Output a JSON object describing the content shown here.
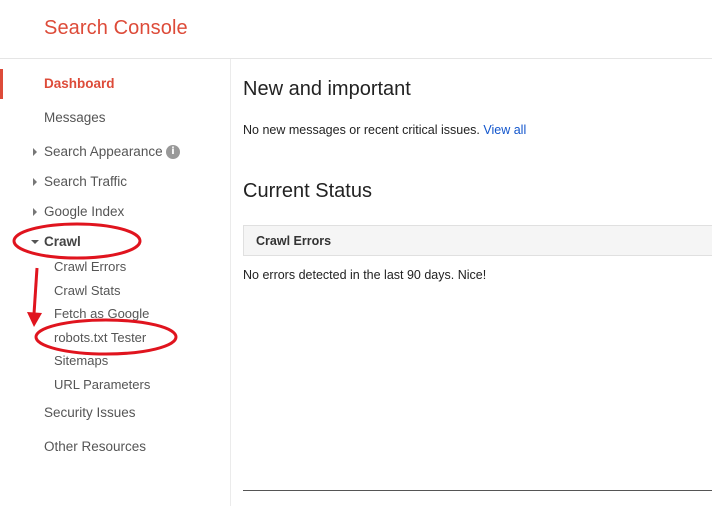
{
  "header": {
    "brand": "Search Console"
  },
  "sidebar": {
    "dashboard": "Dashboard",
    "messages": "Messages",
    "search_appearance": "Search Appearance",
    "search_traffic": "Search Traffic",
    "google_index": "Google Index",
    "crawl": "Crawl",
    "crawl_items": [
      "Crawl Errors",
      "Crawl Stats",
      "Fetch as Google",
      "robots.txt Tester",
      "Sitemaps",
      "URL Parameters"
    ],
    "security_issues": "Security Issues",
    "other_resources": "Other Resources",
    "info_glyph": "i"
  },
  "main": {
    "new_title": "New and important",
    "new_message": "No new messages or recent critical issues.",
    "view_all": "View all",
    "status_title": "Current Status",
    "crawl_errors_panel_title": "Crawl Errors",
    "crawl_errors_message": "No errors detected in the last 90 days. Nice!"
  },
  "colors": {
    "brand": "#dd4b39",
    "link": "#1155cc",
    "annotation": "#e0141e"
  }
}
